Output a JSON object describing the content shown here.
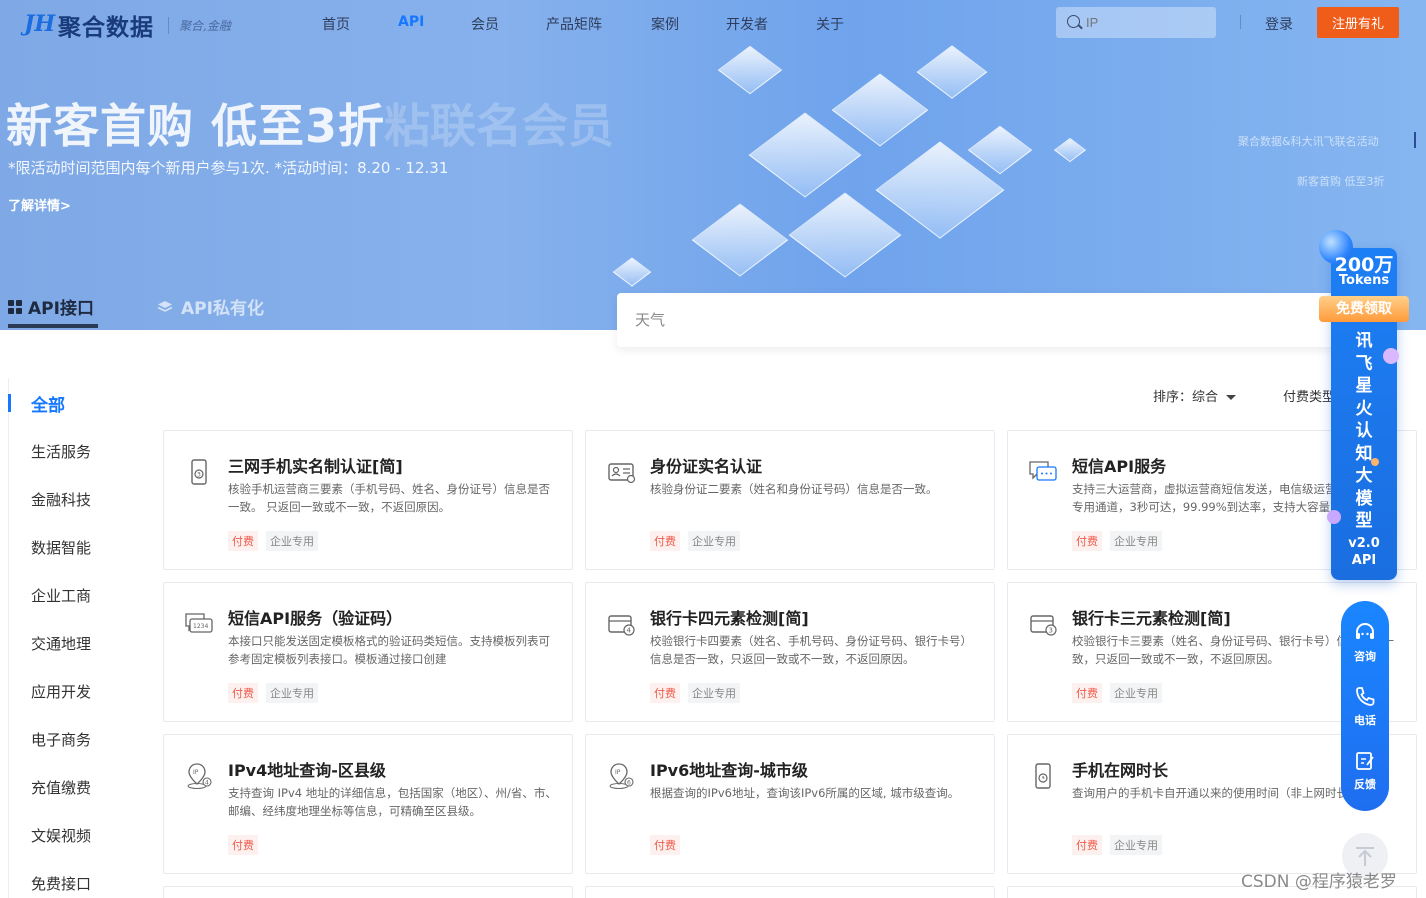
{
  "nav": {
    "brand": "聚合数据",
    "slogan": "聚合,金融",
    "items": [
      "首页",
      "API",
      "会员",
      "产品矩阵",
      "案例",
      "开发者",
      "关于"
    ],
    "active": "API",
    "search_placeholder": "IP",
    "login": "登录",
    "register": "注册有礼"
  },
  "hero": {
    "title": "新客首购 低至3折",
    "title_ghost": "粘联名会员",
    "subtitle": "*限活动时间范围内每个新用户参与1次. *活动时间：8.20 - 12.31",
    "link": "了解详情>",
    "indicators": [
      "聚合数据&科大讯飞联名活动",
      "新客首购 低至3折"
    ]
  },
  "tabs": [
    {
      "label": "API接口",
      "active": true
    },
    {
      "label": "API私有化",
      "active": false
    }
  ],
  "search": {
    "placeholder": "天气"
  },
  "sidebar": {
    "items": [
      "全部",
      "生活服务",
      "金融科技",
      "数据智能",
      "企业工商",
      "交通地理",
      "应用开发",
      "电子商务",
      "充值缴费",
      "文娱视频",
      "免费接口"
    ],
    "active": "全部"
  },
  "sort": {
    "label": "排序：综合",
    "pay_type": "付费类型"
  },
  "tags": {
    "paid": "付费",
    "enterprise": "企业专用"
  },
  "cards": [
    {
      "title": "三网手机实名制认证[简]",
      "desc": "核验手机运营商三要素（手机号码、姓名、身份证号）信息是否一致。 只返回一致或不一致，不返回原因。",
      "icon": "phone-icon",
      "enterprise": true
    },
    {
      "title": "身份证实名认证",
      "desc": "核验身份证二要素（姓名和身份证号码）信息是否一致。",
      "icon": "id-card-icon",
      "enterprise": true
    },
    {
      "title": "短信API服务",
      "desc": "支持三大运营商，虚拟运营商短信发送，电信级运营平台，独享专用通道，3秒可达，99.99%到达率，支持大容量高并发。",
      "icon": "sms-icon",
      "enterprise": true
    },
    {
      "title": "短信API服务（验证码）",
      "desc": "本接口只能发送固定模板格式的验证码类短信。支持模板列表可参考固定模板列表接口。模板通过接口创建",
      "icon": "sms-code-icon",
      "enterprise": true
    },
    {
      "title": "银行卡四元素检测[简]",
      "desc": "校验银行卡四要素（姓名、手机号码、身份证号码、银行卡号）信息是否一致，只返回一致或不一致，不返回原因。",
      "icon": "bank-card-4-icon",
      "enterprise": true
    },
    {
      "title": "银行卡三元素检测[简]",
      "desc": "校验银行卡三要素（姓名、身份证号码、银行卡号）信息是否一致，只返回一致或不一致，不返回原因。",
      "icon": "bank-card-3-icon",
      "enterprise": true
    },
    {
      "title": "IPv4地址查询-区县级",
      "desc": "支持查询 IPv4 地址的详细信息，包括国家（地区）、州/省、市、邮编、经纬度地理坐标等信息，可精确至区县级。",
      "icon": "ipv4-icon",
      "enterprise": false
    },
    {
      "title": "IPv6地址查询-城市级",
      "desc": "根据查询的IPv6地址，查询该IPv6所属的区域, 城市级查询。",
      "icon": "ipv6-icon",
      "enterprise": false
    },
    {
      "title": "手机在网时长",
      "desc": "查询用户的手机卡自开通以来的使用时间（非上网时长）。",
      "icon": "phone-time-icon",
      "enterprise": true
    }
  ],
  "promo": {
    "amount": "200万",
    "unit": "Tokens",
    "cta": "免费领取",
    "vertical": "讯飞星火认知大模型",
    "version": "v2.0",
    "suffix": "API"
  },
  "contact": {
    "items": [
      "咨询",
      "电话",
      "反馈"
    ]
  },
  "watermark": "CSDN @程序猿老罗",
  "colors": {
    "accent": "#1677ff",
    "register": "#f05d1a",
    "paid_tag": "#f05a4a"
  }
}
